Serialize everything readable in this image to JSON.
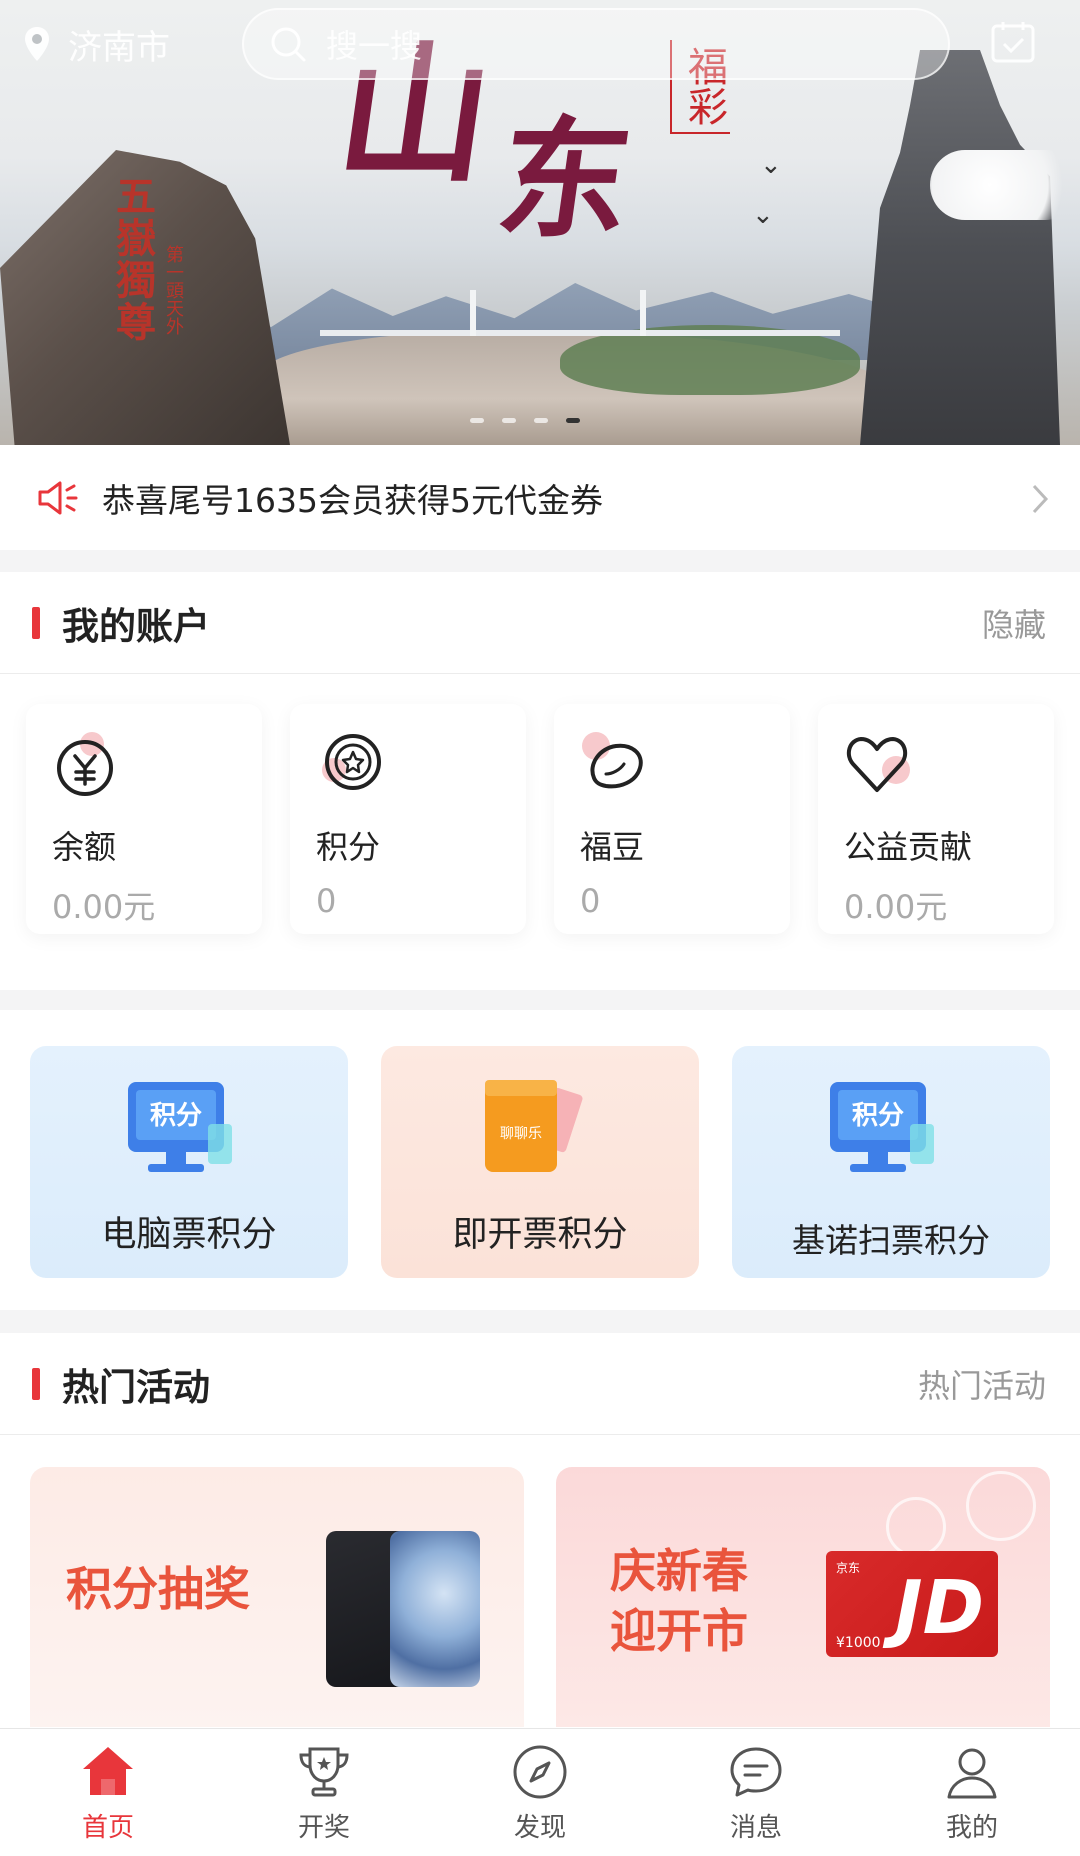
{
  "header": {
    "location": "济南市",
    "search_placeholder": "搜一搜"
  },
  "banner": {
    "calligraphy_1": "山",
    "calligraphy_2": "东",
    "seal_text": "福彩",
    "rock_inscription": "五嶽獨尊",
    "rock_inscription_small": "第一頭天外",
    "slides_total": 4,
    "slide_active": 4
  },
  "notice": {
    "text": "恭喜尾号1635会员获得5元代金券"
  },
  "account": {
    "title": "我的账户",
    "right_action": "隐藏",
    "items": [
      {
        "label": "余额",
        "value": "0.00元",
        "icon": "yuan-coin-icon"
      },
      {
        "label": "积分",
        "value": "0",
        "icon": "star-coin-icon"
      },
      {
        "label": "福豆",
        "value": "0",
        "icon": "bean-icon"
      },
      {
        "label": "公益贡献",
        "value": "0.00元",
        "icon": "heart-icon"
      }
    ]
  },
  "points": {
    "items": [
      {
        "label": "电脑票积分",
        "icon_text": "积分",
        "icon": "computer-points-icon"
      },
      {
        "label": "即开票积分",
        "icon_text": "聊聊乐",
        "icon": "scratch-ticket-icon"
      },
      {
        "label": "基诺扫票积分",
        "icon_text": "积分",
        "icon": "computer-points-icon"
      }
    ]
  },
  "hot": {
    "title": "热门活动",
    "right_action": "热门活动",
    "cards": [
      {
        "title": "积分抽奖"
      },
      {
        "title_line1": "庆新春",
        "title_line2": "迎开市",
        "card_brand": "京东",
        "card_logo": "JD",
        "card_amount": "¥1000"
      }
    ]
  },
  "tabbar": {
    "tabs": [
      {
        "label": "首页",
        "icon": "home-icon",
        "active": true
      },
      {
        "label": "开奖",
        "icon": "trophy-icon",
        "active": false
      },
      {
        "label": "发现",
        "icon": "compass-icon",
        "active": false
      },
      {
        "label": "消息",
        "icon": "message-icon",
        "active": false
      },
      {
        "label": "我的",
        "icon": "user-icon",
        "active": false
      }
    ]
  },
  "colors": {
    "accent": "#e8363b",
    "hot_title": "#e9543c"
  }
}
